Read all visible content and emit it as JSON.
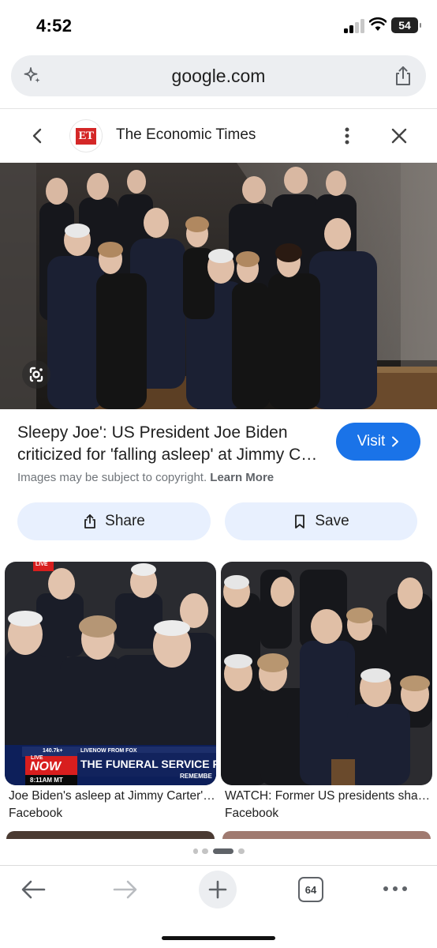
{
  "status": {
    "time": "4:52",
    "battery": "54"
  },
  "urlbar": {
    "domain": "google.com"
  },
  "source": {
    "logo_text": "ET",
    "name": "The Economic Times"
  },
  "result": {
    "title_line1": "Sleepy Joe': US President Joe Biden",
    "title_line2": "criticized for 'falling asleep' at Jimmy Carter's funeral",
    "visit_label": "Visit",
    "copyright_text": "Images may be subject to copyright.",
    "learn_more": "Learn More"
  },
  "actions": {
    "share_label": "Share",
    "save_label": "Save"
  },
  "related": [
    {
      "caption": "Joe Biden's asleep at Jimmy Carter's funeral",
      "source": "Facebook",
      "overlay": {
        "live": "LIVE",
        "viewers": "140.7k+",
        "ticker": "LIVENOW FROM FOX",
        "now": "NOW",
        "live_small": "LIVE",
        "time": "8:11AM MT",
        "headline": "THE FUNERAL SERVICE FO",
        "remember": "REMEMBE"
      }
    },
    {
      "caption": "WATCH: Former US presidents share a laugh",
      "source": "Facebook"
    }
  ],
  "toolbar": {
    "tab_count": "64"
  },
  "colors": {
    "accent": "#1a73e8",
    "chip": "#e8f0fe",
    "et_red": "#d42727"
  }
}
